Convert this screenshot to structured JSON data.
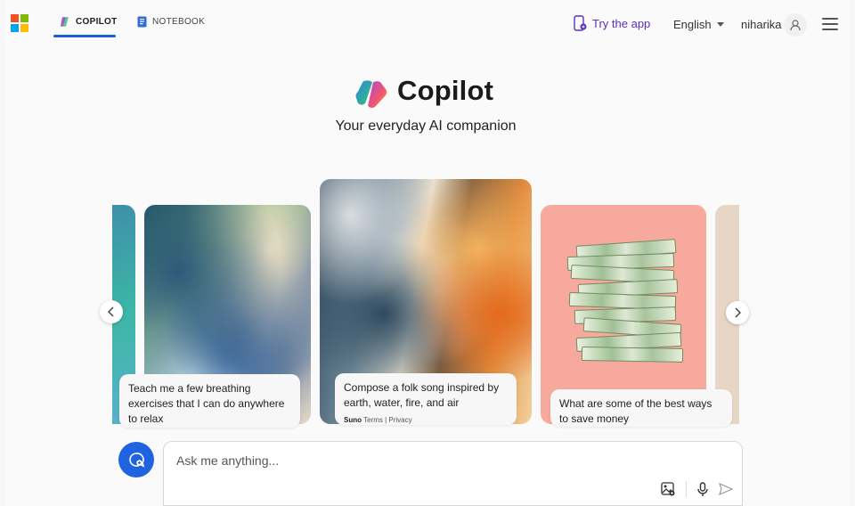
{
  "topbar": {
    "tabs": [
      {
        "label": "COPILOT",
        "active": true
      },
      {
        "label": "NOTEBOOK",
        "active": false
      }
    ],
    "try_app": "Try the app",
    "language": "English",
    "username": "niharika"
  },
  "hero": {
    "title": "Copilot",
    "subtitle": "Your everyday AI companion"
  },
  "carousel": {
    "cards": [
      {
        "text": "Teach me a few breathing exercises that I can do anywhere to relax"
      },
      {
        "text": "Compose a folk song inspired by earth, water, fire, and air",
        "meta_brand": "Suno",
        "meta_terms": "Terms",
        "meta_sep": "|",
        "meta_privacy": "Privacy"
      },
      {
        "text": "What are some of the best ways to save money"
      }
    ]
  },
  "chat": {
    "placeholder": "Ask me anything..."
  },
  "colors": {
    "accent": "#1f63e0",
    "try_app": "#5a2fc1",
    "money_card_bg": "#f6a99c"
  },
  "icons": {
    "microsoft": "microsoft-logo",
    "copilot_tab": "copilot-icon",
    "notebook_tab": "notebook-icon",
    "try_app": "phone-app-icon",
    "language_caret": "chevron-down-icon",
    "user": "user-icon",
    "menu": "hamburger-icon",
    "new_chat": "new-chat-icon",
    "image_upload": "image-icon",
    "mic": "mic-icon",
    "send": "send-icon"
  }
}
